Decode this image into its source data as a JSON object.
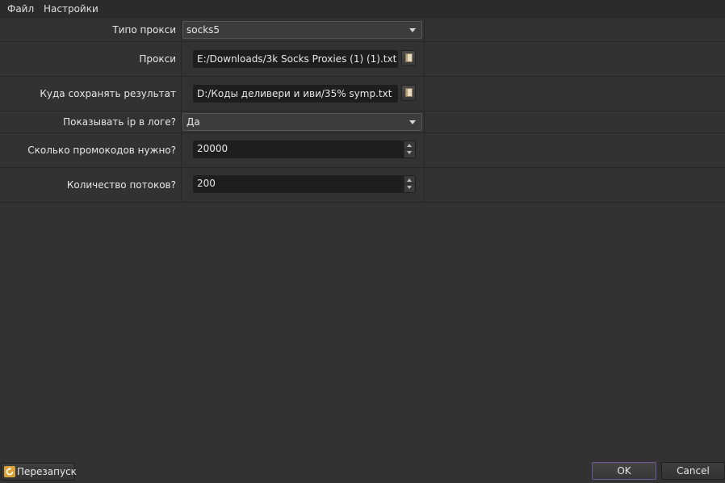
{
  "menubar": {
    "file_label": "Файл",
    "settings_label": "Настройки"
  },
  "settings": {
    "proxy_type": {
      "label": "Типо прокси",
      "value": "socks5"
    },
    "proxy_file": {
      "label": "Прокси",
      "value": "E:/Downloads/3k Socks Proxies (1) (1).txt"
    },
    "save_path": {
      "label": "Куда сохранять результат",
      "value": "D:/Коды деливери и иви/35% symp.txt"
    },
    "show_ip": {
      "label": "Показывать ip в логе?",
      "value": "Да"
    },
    "promo_count": {
      "label": "Сколько промокодов нужно?",
      "value": "20000"
    },
    "thread_count": {
      "label": "Количество потоков?",
      "value": "200"
    }
  },
  "footer": {
    "restart_label": "Перезапуск",
    "ok_label": "OK",
    "cancel_label": "Cancel"
  },
  "icons": {
    "browse": "book-icon",
    "restart": "restart-icon",
    "combo_arrow": "chevron-down-icon"
  },
  "colors": {
    "background": "#323232",
    "menubar": "#2b2b2b",
    "input_bg": "#1e1e1e",
    "ok_border": "#6a5a9a"
  }
}
